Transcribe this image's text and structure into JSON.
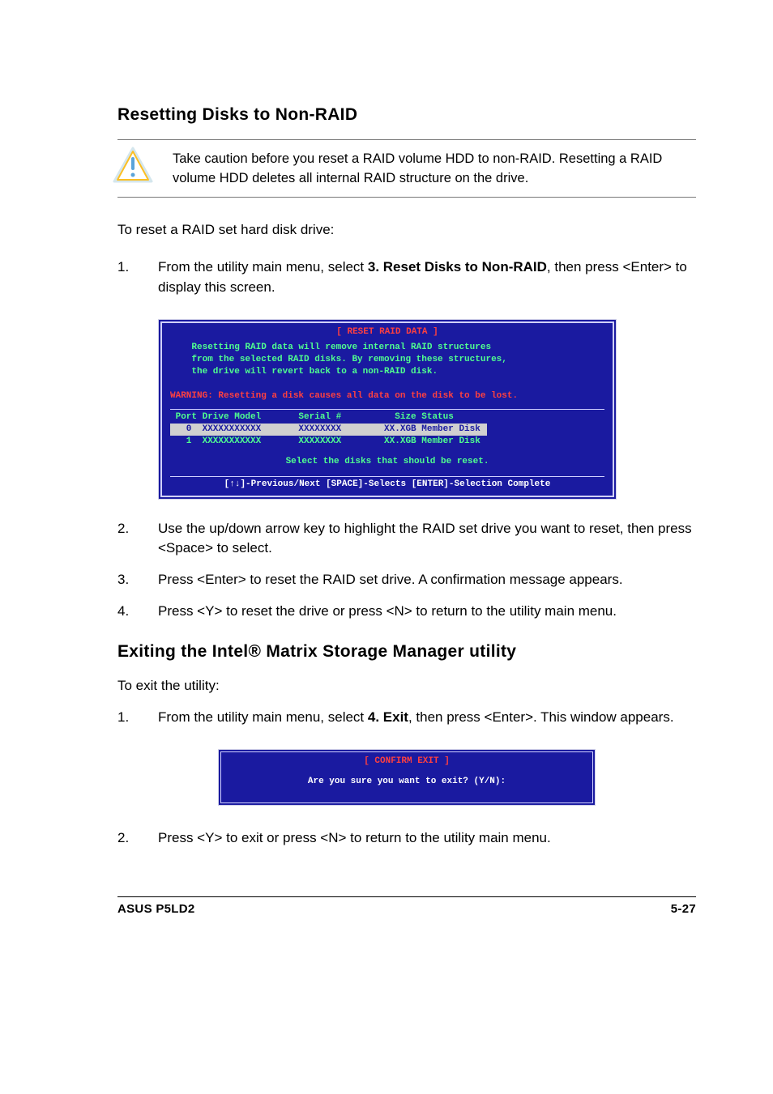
{
  "section1": {
    "heading": "Resetting Disks to Non-RAID",
    "caution": "Take caution before you reset a RAID volume HDD to non-RAID. Resetting a RAID volume HDD deletes all internal RAID structure on the drive.",
    "intro": "To reset a RAID set hard disk drive:",
    "steps": {
      "s1_pre": "From the utility main menu, select ",
      "s1_bold": "3. Reset Disks to Non-RAID",
      "s1_post": ", then press <Enter> to display this screen.",
      "s2": "Use the up/down arrow key to highlight the RAID set drive you want to reset, then press <Space> to select.",
      "s3": "Press <Enter> to reset the RAID set drive. A confirmation message appears.",
      "s4": "Press <Y> to reset the drive or press <N> to return to the utility main menu."
    }
  },
  "term1": {
    "title": "[ RESET RAID DATA ]",
    "body_line1": "Resetting RAID data will remove internal RAID structures",
    "body_line2": "from the selected RAID disks. By removing these structures,",
    "body_line3": "the drive will revert back to a non-RAID disk.",
    "warning": "WARNING: Resetting a disk causes all data on the disk to be lost.",
    "header_row": " Port Drive Model       Serial #          Size Status",
    "row0": "   0  XXXXXXXXXXX       XXXXXXXX        XX.XGB Member Disk ",
    "row1": "   1  XXXXXXXXXXX       XXXXXXXX        XX.XGB Member Disk",
    "prompt": "Select the disks that should be reset.",
    "footer": "[↑↓]-Previous/Next  [SPACE]-Selects  [ENTER]-Selection Complete"
  },
  "section2": {
    "heading": "Exiting the Intel® Matrix Storage Manager utility",
    "intro": "To exit the utility:",
    "steps": {
      "s1_pre": "From the utility main menu, select ",
      "s1_bold": "4. Exit",
      "s1_post": ", then press <Enter>. This window appears.",
      "s2": "Press <Y> to exit or press <N> to return to the utility main menu."
    }
  },
  "term2": {
    "title": "[ CONFIRM EXIT ]",
    "msg": "Are you sure you want to exit? (Y/N):"
  },
  "footer": {
    "left": "ASUS P5LD2",
    "right": "5-27"
  }
}
